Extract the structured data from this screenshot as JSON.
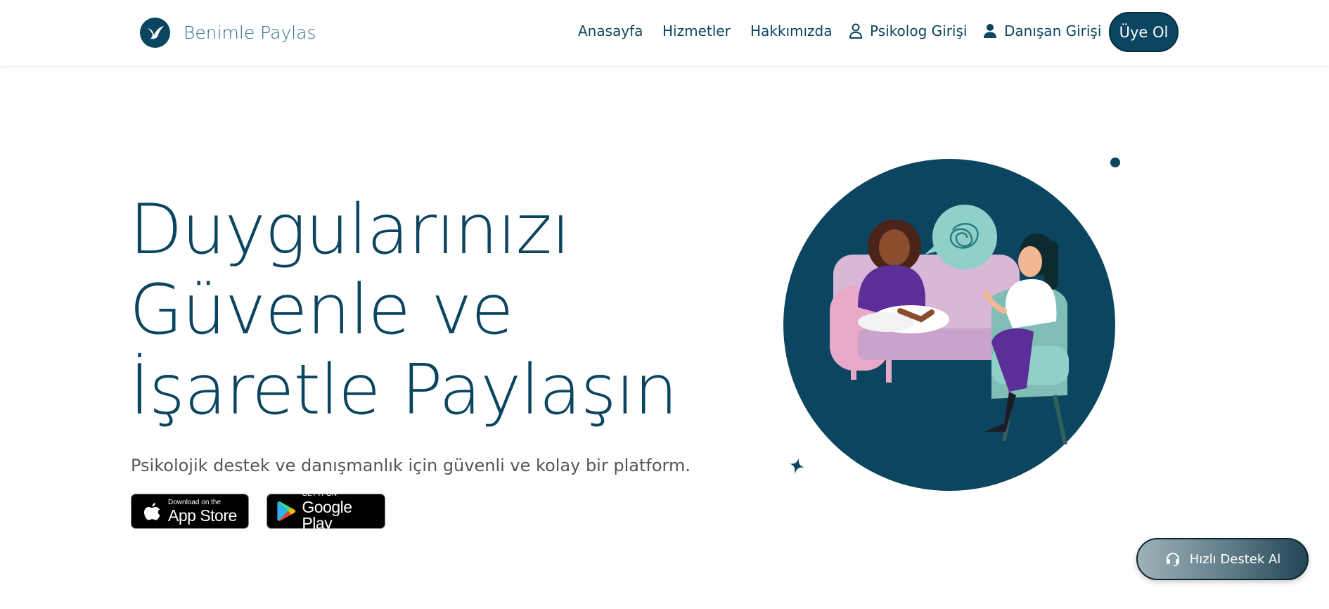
{
  "brand": {
    "name": "Benimle Paylas",
    "logo_icon": "bird-icon"
  },
  "nav": {
    "items": [
      {
        "label": "Anasayfa"
      },
      {
        "label": "Hizmetler"
      },
      {
        "label": "Hakkımızda"
      },
      {
        "label": "Psikolog Girişi",
        "icon": "user-outline-icon"
      },
      {
        "label": "Danışan Girişi",
        "icon": "user-filled-icon"
      }
    ],
    "signup_label": "Üye Ol"
  },
  "hero": {
    "title_lines": [
      "Duygularınızı",
      "Güvenle ve",
      "İşaretle Paylaşın"
    ],
    "subtitle": "Psikolojik destek ve danışmanlık için güvenli ve kolay bir platform."
  },
  "badges": {
    "app_store": {
      "small": "Download on the",
      "big": "App Store",
      "icon": "apple-icon"
    },
    "google_play": {
      "small": "GET IT ON",
      "big": "Google Play",
      "icon": "google-play-icon"
    }
  },
  "support": {
    "label": "Hızlı Destek Al",
    "icon": "headset-icon"
  },
  "colors": {
    "primary": "#0b4560",
    "accent_teal": "#8fd1c9",
    "purple": "#5b2e99",
    "pink": "#e8a9c8"
  }
}
